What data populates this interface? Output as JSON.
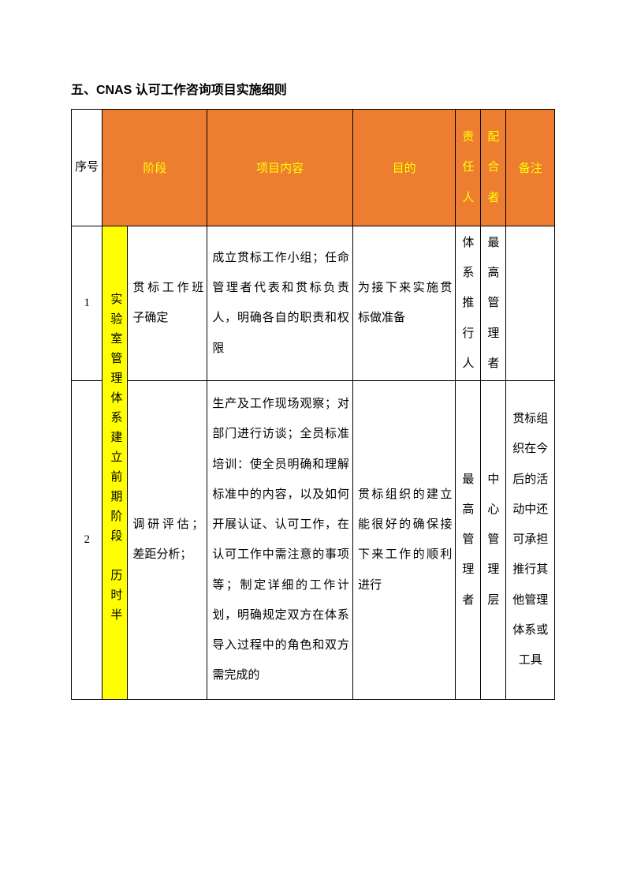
{
  "title": "五、CNAS 认可工作咨询项目实施细则",
  "headers": {
    "seq": "序号",
    "phase": "阶段",
    "content": "项目内容",
    "purpose": "目的",
    "responsible": "责任人",
    "cooperator": "配合者",
    "remark": "备注"
  },
  "phase_label": "实验室管理体系建立前期阶段　历时半",
  "rows": [
    {
      "seq": "1",
      "stage": "贯标工作班子确定",
      "content": "成立贯标工作小组；任命管理者代表和贯标负责人，明确各自的职责和权限",
      "purpose": "为接下来实施贯标做准备",
      "responsible": "体系推行人",
      "cooperator": "最高管理者",
      "remark": ""
    },
    {
      "seq": "2",
      "stage": "调研评估；差距分析；",
      "content": "生产及工作现场观察；对部门进行访谈；全员标准培训：使全员明确和理解标准中的内容，以及如何开展认证、认可工作，在认可工作中需注意的事项等；制定详细的工作计划，明确规定双方在体系导入过程中的角色和双方需完成的",
      "purpose": "贯标组织的建立能很好的确保接下来工作的顺利进行",
      "responsible": "最高管理者",
      "cooperator": "中心管理层",
      "remark": "贯标组织在今后的活动中还可承担推行其他管理体系或工具"
    }
  ]
}
